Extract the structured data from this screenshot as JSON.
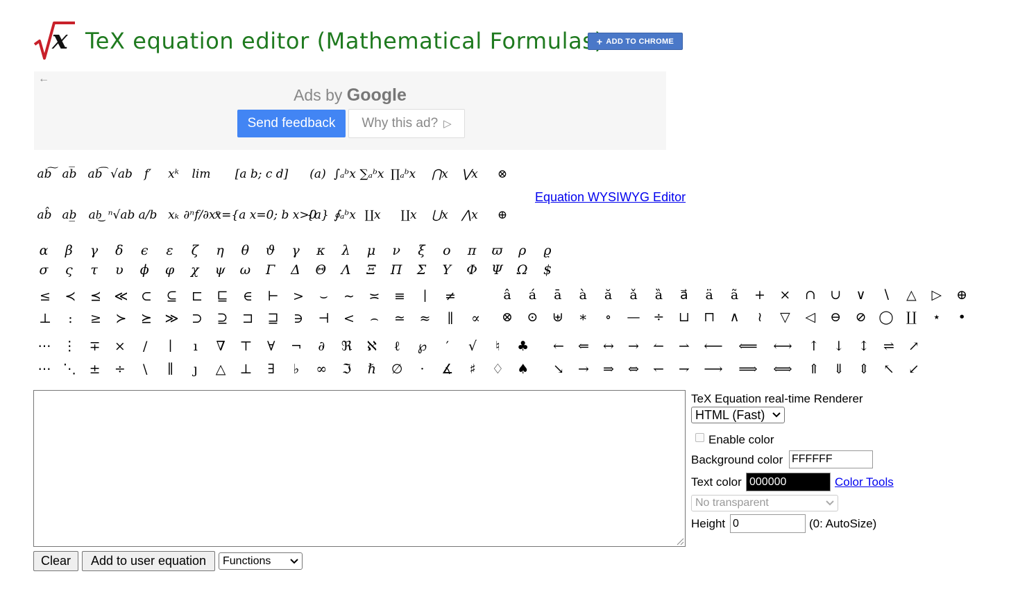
{
  "header": {
    "title": "TeX equation editor (Mathematical Formulas)",
    "chrome_button": "ADD TO CHROME",
    "chrome_icon": "plus-icon",
    "logo_icon": "sqrt-x-logo-icon"
  },
  "ad": {
    "back_icon": "←",
    "label_prefix": "Ads by",
    "label_brand": "Google",
    "send_feedback": "Send feedback",
    "why_this_ad": "Why this ad?",
    "why_icon": "▷"
  },
  "wysiwyg_link": "Equation WYSIWYG Editor",
  "symbols": {
    "templates_row1": [
      "ab͠",
      "ab̅",
      "ab͡",
      "√ab",
      "f′",
      "xᵏ",
      "lim",
      "[a b; c d]",
      "(a)",
      "∫ₐᵇx",
      "∑ₐᵇx",
      "∏ₐᵇx",
      "⋂x",
      "⋁x",
      "⊗"
    ],
    "templates_row2": [
      "ab̂",
      "ab̲",
      "ab͜",
      "ⁿ√ab",
      "a/b",
      "xₖ",
      "∂ⁿf/∂xⁿ",
      "x={a x=0; b x>0",
      "{a}",
      "∮ₐᵇx",
      "∐x",
      "∐x",
      "⋃x",
      "⋀x",
      "⊕"
    ],
    "greek_row1": [
      "α",
      "β",
      "γ",
      "δ",
      "ϵ",
      "ε",
      "ζ",
      "η",
      "θ",
      "ϑ",
      "γ",
      "κ",
      "λ",
      "μ",
      "ν",
      "ξ",
      "o",
      "π",
      "ϖ",
      "ρ",
      "ϱ"
    ],
    "greek_row2": [
      "σ",
      "ς",
      "τ",
      "υ",
      "ϕ",
      "φ",
      "χ",
      "ψ",
      "ω",
      "Γ",
      "Δ",
      "Θ",
      "Λ",
      "Ξ",
      "Π",
      "Σ",
      "Υ",
      "Φ",
      "Ψ",
      "Ω",
      "$"
    ],
    "rel_row1": [
      "≤",
      "≺",
      "⪯",
      "≪",
      "⊂",
      "⊆",
      "⊏",
      "⊑",
      "∈",
      "⊢",
      ">",
      "⌣",
      "∼",
      "≍",
      "≡",
      "∣",
      "≠"
    ],
    "rel_row2": [
      "⊥",
      ":",
      "≥",
      "≻",
      "⪰",
      "≫",
      "⊃",
      "⊇",
      "⊐",
      "⊒",
      "∋",
      "⊣",
      "<",
      "⌢",
      "≃",
      "≈",
      "∥",
      "∝"
    ],
    "accent_row1": [
      "â",
      "á",
      "ā",
      "à",
      "ă",
      "ǎ",
      "ȁ",
      "a⃗",
      "ä",
      "ã",
      "+",
      "×",
      "∩",
      "∪",
      "∨",
      "∖",
      "△",
      "▷",
      "⊕"
    ],
    "accent_row2": [
      "⊗",
      "⊙",
      "⊎",
      "∗",
      "∘",
      "—",
      "÷",
      "⊔",
      "⊓",
      "∧",
      "≀",
      "▽",
      "◁",
      "⊖",
      "⊘",
      "◯",
      "∐",
      "⋆",
      "•"
    ],
    "misc_row1": [
      "⋯",
      "⋮",
      "∓",
      "×",
      "/",
      "∣",
      "ı",
      "∇",
      "⊤",
      "∀",
      "¬",
      "∂",
      "ℜ",
      "ℵ",
      "ℓ",
      "℘",
      "′",
      "√",
      "♮",
      "♣"
    ],
    "misc_row2": [
      "⋯",
      "⋱",
      "±",
      "÷",
      "\\",
      "∥",
      "ȷ",
      "△",
      "⊥",
      "∃",
      "♭",
      "∞",
      "ℑ",
      "ℏ",
      "∅",
      "·",
      "∡",
      "♯",
      "♢",
      "♠"
    ],
    "arrow_row1": [
      "←",
      "⇐",
      "↔",
      "→",
      "↼",
      "⇀",
      "⟵",
      "⟸",
      "⟷",
      "↑",
      "↓",
      "↕",
      "⇌",
      "↗"
    ],
    "arrow_row2": [
      "↘",
      "→",
      "⇒",
      "⇔",
      "↽",
      "⇁",
      "⟶",
      "⟹",
      "⟺",
      "⇑",
      "⇓",
      "⇕",
      "↖",
      "↙"
    ]
  },
  "editor": {
    "value": ""
  },
  "buttons": {
    "clear": "Clear",
    "add_user_equation": "Add to user equation",
    "functions_select": "Functions"
  },
  "panel": {
    "renderer_label": "TeX Equation real-time Renderer",
    "renderer_value": "HTML (Fast)",
    "enable_color_label": "Enable color",
    "enable_color_checked": false,
    "bg_color_label": "Background color",
    "bg_color_value": "FFFFFF",
    "text_color_label": "Text color",
    "text_color_value": "000000",
    "color_tools_link": "Color Tools",
    "transparent_value": "No transparent",
    "height_label": "Height",
    "height_value": "0",
    "height_hint": "(0: AutoSize)"
  },
  "colors": {
    "title_green": "#1f7a1f",
    "chrome_blue": "#4a78c8",
    "feedback_blue": "#4285f4",
    "link_blue": "#0000ee"
  }
}
